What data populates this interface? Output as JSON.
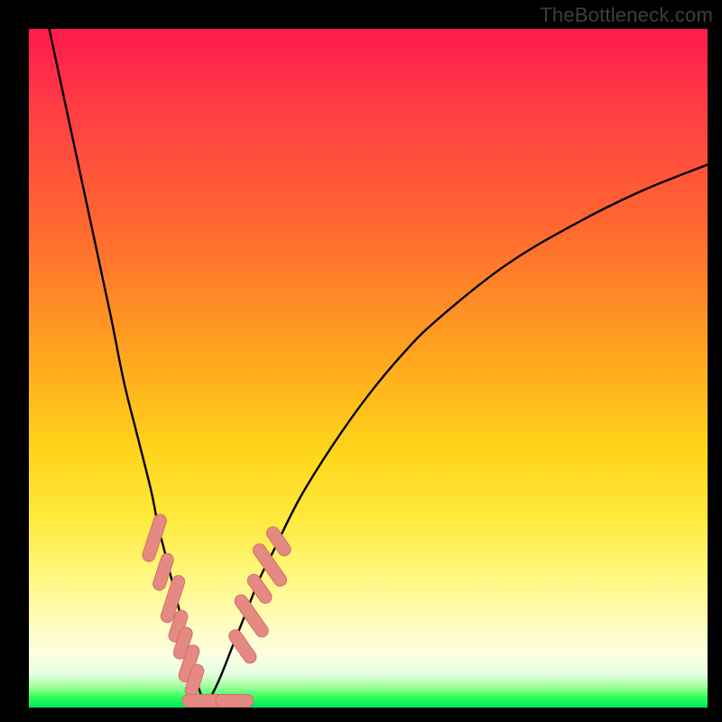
{
  "watermark": "TheBottleneck.com",
  "colors": {
    "curve": "#000000",
    "marker_fill": "#e58a82",
    "marker_stroke": "#d46e66"
  },
  "chart_data": {
    "type": "line",
    "title": "",
    "xlabel": "",
    "ylabel": "",
    "xlim": [
      0,
      100
    ],
    "ylim": [
      0,
      100
    ],
    "legend": false,
    "grid": false,
    "notes": "V-shaped bottleneck curve. Left branch descends steeply from upper-left to a minimum near x≈26, y≈0; right branch rises with decreasing slope toward x≈100, y≈80. Salmon-colored capsule markers cluster along both branches near the bottom of the V (roughly y between 2 and 25).",
    "series": [
      {
        "name": "left_branch",
        "x": [
          3,
          6,
          9,
          12,
          14,
          16,
          18,
          19,
          20,
          21,
          22,
          23,
          24,
          25,
          26
        ],
        "y": [
          100,
          86,
          72,
          58,
          48,
          40,
          32,
          27,
          23,
          19,
          15,
          11,
          7,
          3,
          0
        ]
      },
      {
        "name": "right_branch",
        "x": [
          26,
          28,
          30,
          32,
          34,
          36,
          40,
          45,
          50,
          55,
          60,
          70,
          80,
          90,
          100
        ],
        "y": [
          0,
          4,
          9,
          14,
          19,
          23,
          31,
          39,
          46,
          52,
          57,
          65,
          71,
          76,
          80
        ]
      }
    ],
    "markers": [
      {
        "x": 18.5,
        "y": 25,
        "len": 4,
        "angle": -72
      },
      {
        "x": 19.8,
        "y": 20,
        "len": 3,
        "angle": -72
      },
      {
        "x": 21.2,
        "y": 16,
        "len": 4,
        "angle": -72
      },
      {
        "x": 22.0,
        "y": 12,
        "len": 2.5,
        "angle": -72
      },
      {
        "x": 22.7,
        "y": 9.5,
        "len": 2.5,
        "angle": -72
      },
      {
        "x": 23.6,
        "y": 6.5,
        "len": 3,
        "angle": -72
      },
      {
        "x": 24.4,
        "y": 4.0,
        "len": 2.5,
        "angle": -72
      },
      {
        "x": 27.0,
        "y": 1.0,
        "len": 5,
        "angle": 0
      },
      {
        "x": 30.3,
        "y": 1.0,
        "len": 3,
        "angle": 0
      },
      {
        "x": 31.5,
        "y": 9.0,
        "len": 3,
        "angle": 55
      },
      {
        "x": 32.8,
        "y": 13.5,
        "len": 4,
        "angle": 55
      },
      {
        "x": 34.0,
        "y": 17.5,
        "len": 2.5,
        "angle": 55
      },
      {
        "x": 35.5,
        "y": 21.0,
        "len": 4,
        "angle": 55
      },
      {
        "x": 36.8,
        "y": 24.5,
        "len": 2.5,
        "angle": 55
      }
    ]
  }
}
